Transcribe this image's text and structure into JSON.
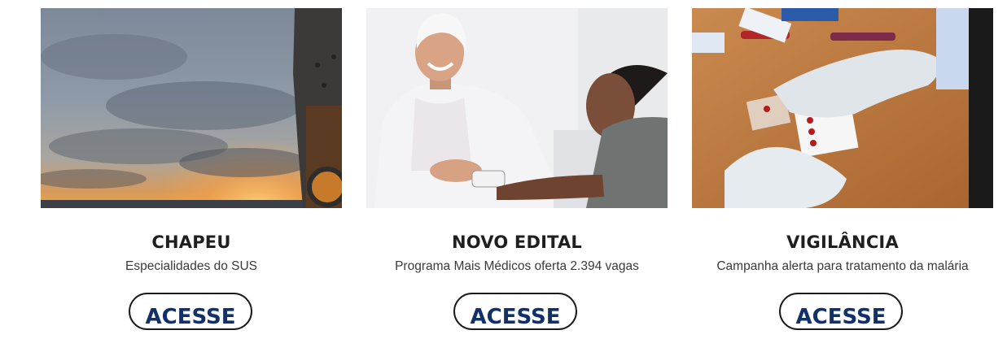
{
  "cards": [
    {
      "title": "CHAPEU",
      "subtitle": "Especialidades do SUS",
      "button_label": "ACESSE",
      "image": "sunset-sky-ship-photo"
    },
    {
      "title": "NOVO EDITAL",
      "subtitle": "Programa Mais Médicos oferta 2.394 vagas",
      "button_label": "ACESSE",
      "image": "doctor-measuring-blood-pressure-photo"
    },
    {
      "title": "VIGILÂNCIA",
      "subtitle": "Campanha alerta para tratamento da malária",
      "button_label": "ACESSE",
      "image": "malaria-blood-test-slides-photo"
    }
  ],
  "colors": {
    "button_text": "#12306a",
    "button_border": "#1b1b1b",
    "title_text": "#1f1f1f"
  }
}
